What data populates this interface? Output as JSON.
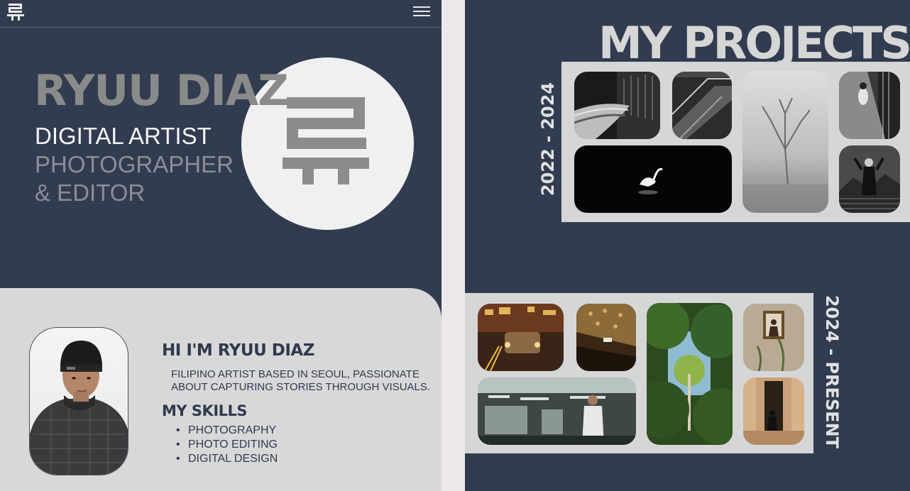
{
  "header": {
    "logo_icon": "korean-ryu-logo",
    "menu_icon": "hamburger-menu-icon"
  },
  "hero": {
    "name": "RYUU DIAZ",
    "role_primary": "DIGITAL ARTIST",
    "role_secondary_1": "PHOTOGRAPHER",
    "role_secondary_2": "& EDITOR",
    "emblem_icon": "korean-ryu-glyph"
  },
  "about": {
    "title": "HI I'M RYUU DIAZ",
    "text": "FILIPINO ARTIST BASED IN SEOUL, PASSIONATE ABOUT CAPTURING STORIES THROUGH VISUALS."
  },
  "skills": {
    "title": "MY SKILLS",
    "items": [
      "PHOTOGRAPHY",
      "PHOTO EDITING",
      "DIGITAL DESIGN"
    ]
  },
  "projects": {
    "title": "MY PROJECTS",
    "groups": [
      {
        "years": "2022 - 2024"
      },
      {
        "years": "2024 - PRESENT"
      }
    ]
  },
  "colors": {
    "navy": "#313c51",
    "light_gray": "#d8d8d9",
    "panel_gray": "#d6d6d6",
    "text_dark": "#2f3a4f",
    "muted_gray": "#8a8a8a"
  }
}
